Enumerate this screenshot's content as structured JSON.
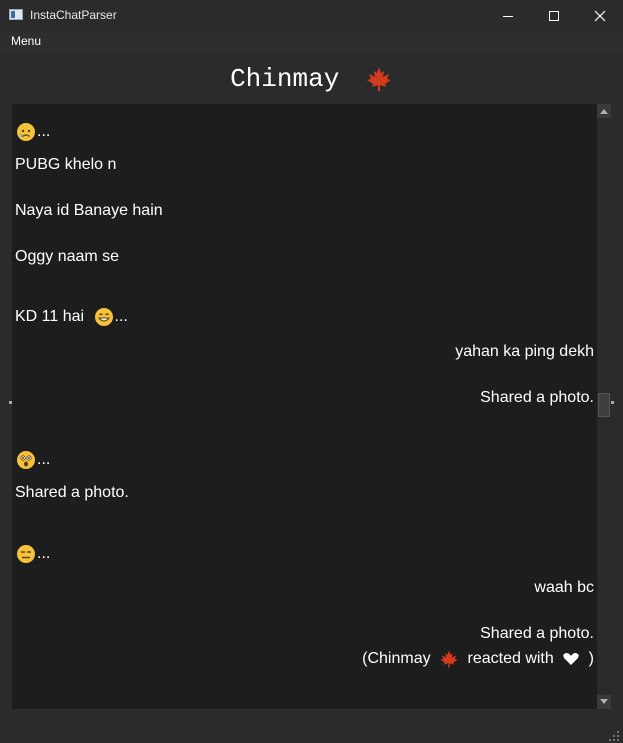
{
  "window": {
    "title": "InstaChatParser"
  },
  "menubar": {
    "menu_label": "Menu"
  },
  "chat": {
    "title": "Chinmay",
    "messages": [
      {
        "side": "left",
        "text": "",
        "emoji": "crying-face",
        "ellipsis": "..."
      },
      {
        "side": "left",
        "text": "PUBG khelo n"
      },
      {
        "side": "left",
        "text": "Naya id Banaye hain"
      },
      {
        "side": "left",
        "text": "Oggy naam se"
      },
      {
        "side": "left",
        "text": "KD 11 hai",
        "emoji": "grinning-face",
        "ellipsis": "..."
      },
      {
        "side": "right",
        "text": "yahan ka ping dekh"
      },
      {
        "side": "right",
        "text": "Shared a photo."
      },
      {
        "side": "left",
        "text": "",
        "emoji": "astonished-face",
        "ellipsis": "..."
      },
      {
        "side": "left",
        "text": "Shared a photo."
      },
      {
        "side": "left",
        "text": "",
        "emoji": "expressionless-face",
        "ellipsis": "..."
      },
      {
        "side": "right",
        "text": "waah bc"
      },
      {
        "side": "right",
        "text": "Shared a photo."
      }
    ],
    "reaction": {
      "open": "(Chinmay",
      "middle": "reacted with",
      "close": ")"
    }
  },
  "colors": {
    "background": "#2b2b2b",
    "chat_bg": "#1d1d1d",
    "text": "#ffffff",
    "leaf": "#d63a1e",
    "emoji": "#f5c33b"
  }
}
